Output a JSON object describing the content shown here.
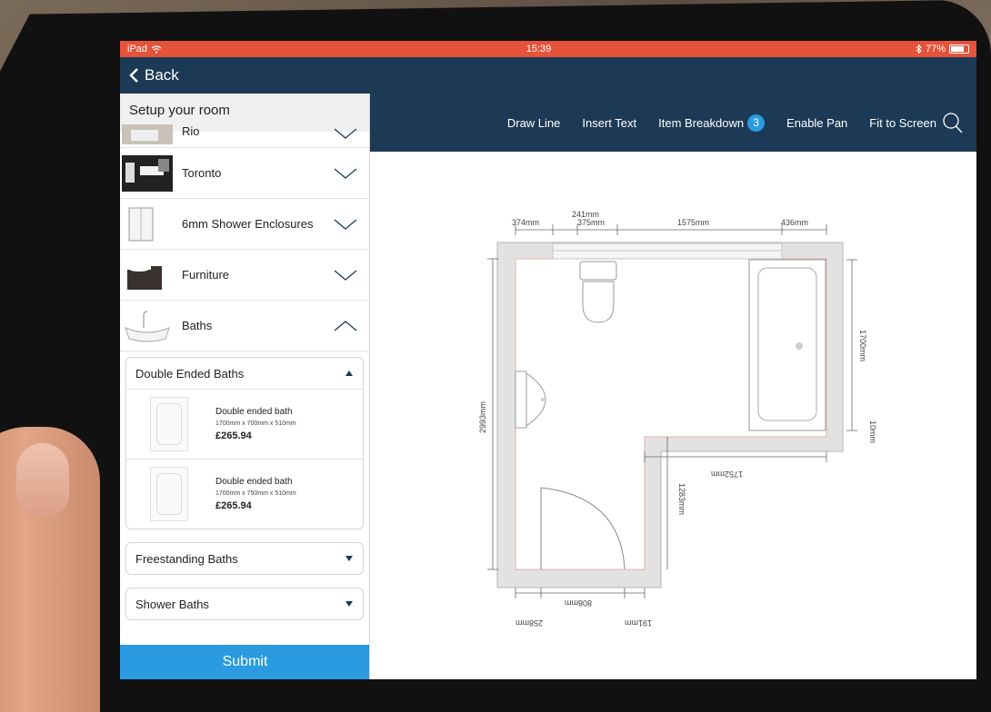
{
  "status": {
    "carrier": "iPad",
    "time": "15:39",
    "battery": "77%",
    "battery_level": 0.77
  },
  "nav": {
    "back": "Back"
  },
  "toolbar": {
    "draw_line": "Draw Line",
    "insert_text": "Insert Text",
    "item_breakdown": "Item Breakdown",
    "item_count": "3",
    "enable_pan": "Enable Pan",
    "fit_to_screen": "Fit to Screen"
  },
  "sidebar": {
    "title": "Setup your room",
    "ranges": [
      {
        "label": "Rio"
      },
      {
        "label": "Toronto"
      },
      {
        "label": "6mm Shower Enclosures"
      },
      {
        "label": "Furniture"
      },
      {
        "label": "Baths"
      }
    ],
    "double_ended": {
      "title": "Double Ended Baths",
      "products": [
        {
          "name": "Double ended bath",
          "size": "1700mm x 700mm x 510mm",
          "price": "£265.94"
        },
        {
          "name": "Double ended bath",
          "size": "1700mm x 750mm x 510mm",
          "price": "£265.94"
        }
      ]
    },
    "freestanding": "Freestanding Baths",
    "shower_baths": "Shower Baths",
    "submit": "Submit"
  },
  "plan": {
    "dims": {
      "d241": "241mm",
      "d374": "374mm",
      "d375": "375mm",
      "d1575": "1575mm",
      "d436": "436mm",
      "d2993": "2993mm",
      "d1700": "1700mm",
      "d10": "10mm",
      "d1752": "1752mm",
      "d1283": "1283mm",
      "d808": "808mm",
      "d258": "258mm",
      "d191": "191mm"
    }
  }
}
